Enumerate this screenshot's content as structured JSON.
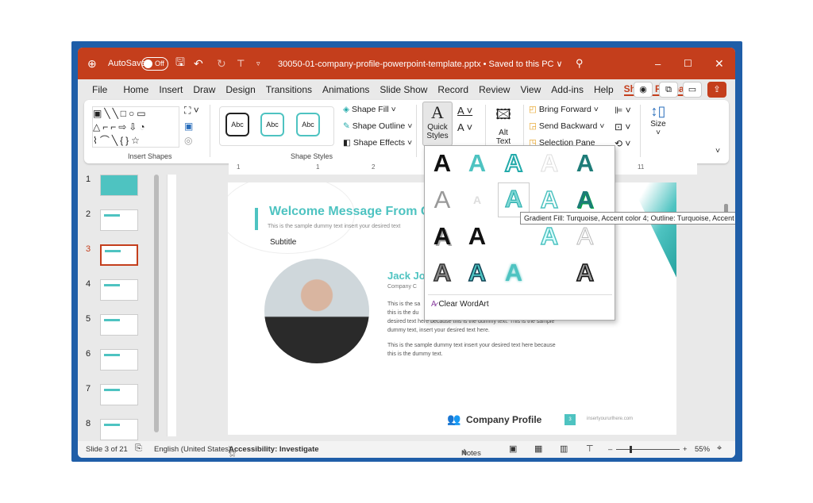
{
  "titlebar": {
    "autosave": "AutoSave",
    "toggle": "Off",
    "filename": "30050-01-company-profile-powerpoint-template.pptx • Saved to this PC ∨"
  },
  "tabs": [
    "File",
    "Home",
    "Insert",
    "Draw",
    "Design",
    "Transitions",
    "Animations",
    "Slide Show",
    "Record",
    "Review",
    "View",
    "Add-ins",
    "Help",
    "Shape Format"
  ],
  "ribbon": {
    "insert_shapes": "Insert Shapes",
    "shape_styles": "Shape Styles",
    "abc": "Abc",
    "shape_fill": "Shape Fill",
    "shape_outline": "Shape Outline",
    "shape_effects": "Shape Effects",
    "quick_styles": "Quick Styles",
    "alt_text": "Alt Text",
    "bring_forward": "Bring Forward",
    "send_backward": "Send Backward",
    "selection_pane": "Selection Pane",
    "size": "Size"
  },
  "ruler": [
    "1",
    "1",
    "2",
    "3",
    "4",
    "11"
  ],
  "thumbnails": [
    "1",
    "2",
    "3",
    "4",
    "5",
    "6",
    "7",
    "8"
  ],
  "selected_slide": "3",
  "slide": {
    "title": "Welcome Message From C",
    "subtitle_text": "This is the sample dummy text insert your desired text",
    "subtitle": "Subtitle",
    "name": "Jack Jo",
    "role": "Company C",
    "para1": [
      "This is the sa",
      "this is the du",
      "desired text here because this is the dummy text. This is the sample",
      "dummy text, insert your desired text here."
    ],
    "para2": [
      "This is the sample dummy text insert your desired text here because",
      "this is the dummy text."
    ],
    "footer": "Company Profile",
    "page": "3",
    "url": "insertyoururlhere.com"
  },
  "gallery": {
    "letter": "A",
    "clear": "Clear WordArt",
    "tooltip": "Gradient Fill: Turquoise, Accent color 4; Outline: Turquoise, Accent color 4"
  },
  "status": {
    "slide": "Slide 3 of 21",
    "language": "English (United States)",
    "accessibility": "Accessibility: Investigate",
    "notes": "Notes",
    "zoom": "55%"
  },
  "colors": {
    "accent": "#c43e1c",
    "turquoise": "#4ec3c1",
    "dark_teal": "#1e7c78"
  }
}
